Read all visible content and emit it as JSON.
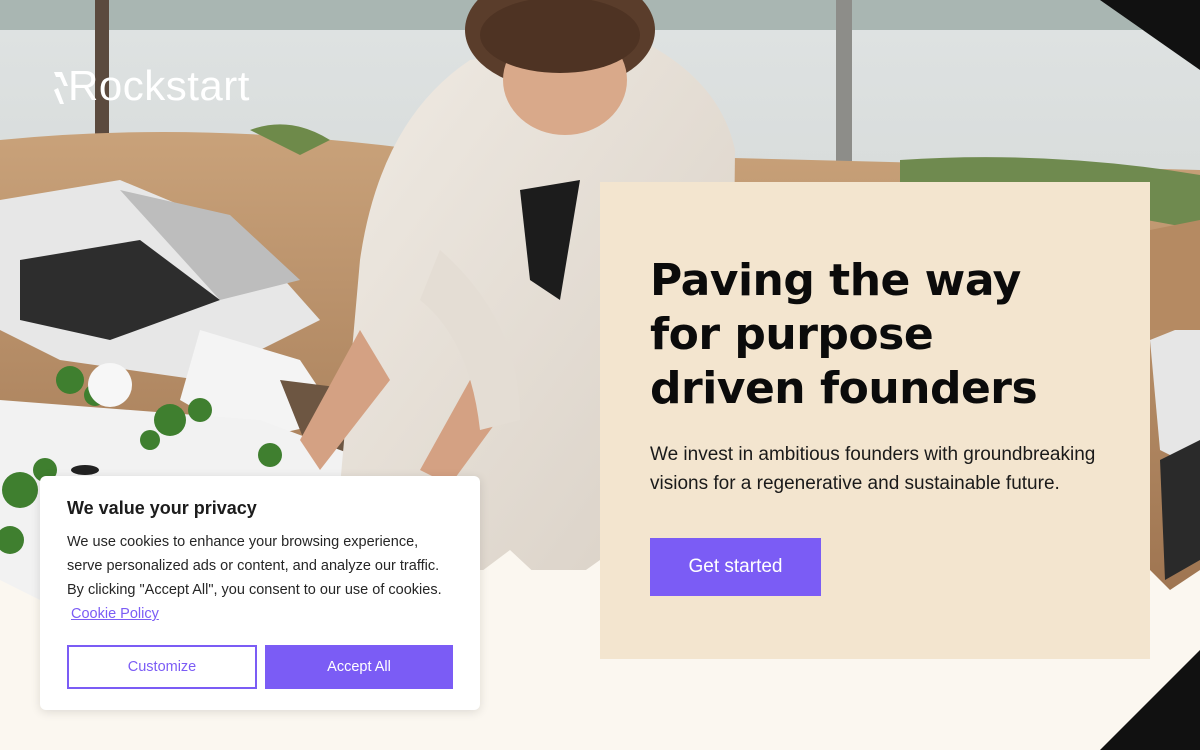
{
  "brand": {
    "name": "Rockstart",
    "accent": "#7b5cf5",
    "card_bg": "#f3e5cf",
    "cream_bg": "#fbf7f0"
  },
  "hero": {
    "image": "woman-planting-seedlings-photo",
    "heading": "Paving the way for purpose driven founders",
    "subheading": "We invest in ambitious founders with groundbreaking visions for a regenerative and sustainable future.",
    "cta_label": "Get started"
  },
  "cookie_banner": {
    "title": "We value your privacy",
    "description": "We use cookies to enhance your browsing experience, serve personalized ads or content, and analyze our traffic. By clicking \"Accept All\", you consent to our use of cookies.",
    "policy_link": "Cookie Policy",
    "customize_label": "Customize",
    "accept_label": "Accept All"
  }
}
